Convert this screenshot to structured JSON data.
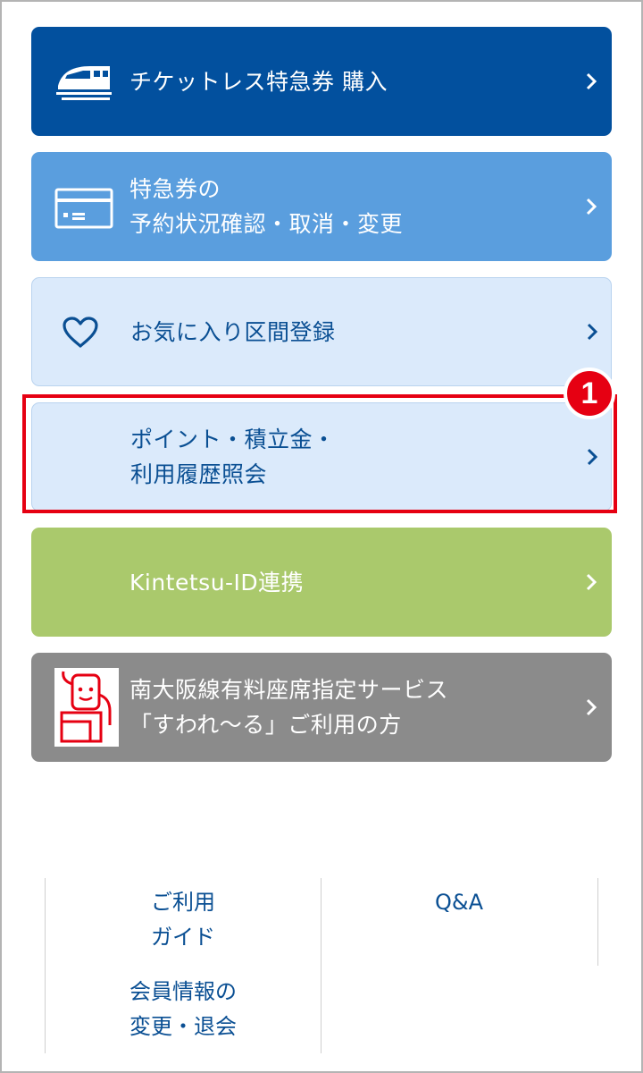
{
  "menu": {
    "ticketless": {
      "label": "チケットレス特急券 購入",
      "icon": "train-icon"
    },
    "reservation": {
      "line1": "特急券の",
      "line2": "予約状況確認・取消・変更",
      "icon": "ticket-card-icon"
    },
    "favorite": {
      "label": "お気に入り区間登録",
      "icon": "heart-icon"
    },
    "points": {
      "line1": "ポイント・積立金・",
      "line2": "利用履歴照会"
    },
    "kintetsu_id": {
      "label": "Kintetsu-ID連携"
    },
    "suwaruru": {
      "line1": "南大阪線有料座席指定サービス",
      "line2": "「すわれ～る」ご利用の方",
      "icon": "suwaruru-mascot-icon"
    }
  },
  "annotation": {
    "step": "1"
  },
  "footer": {
    "guide": {
      "line1": "ご利用",
      "line2": "ガイド"
    },
    "qa": {
      "label": "Q&A"
    },
    "member": {
      "line1": "会員情報の",
      "line2": "変更・退会"
    }
  },
  "colors": {
    "primary": "#02509e",
    "light_blue": "#5a9ede",
    "pale_blue": "#dbeafb",
    "green": "#aac96c",
    "gray": "#8b8b8b",
    "highlight_red": "#e60012"
  }
}
